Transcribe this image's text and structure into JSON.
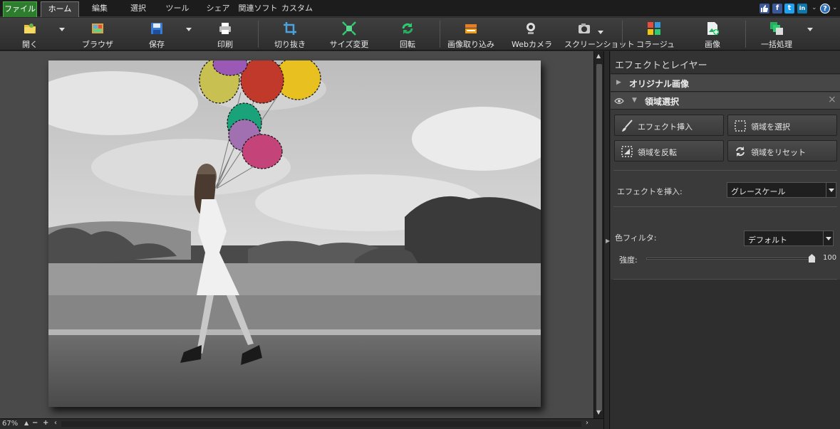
{
  "menu": {
    "tabs": [
      "ファイル",
      "ホーム",
      "編集",
      "選択",
      "ツール",
      "シェア",
      "関連ソフト",
      "カスタム"
    ],
    "social": [
      "like-icon",
      "facebook-icon",
      "twitter-icon",
      "linkedin-icon",
      "help-icon"
    ],
    "social_glyphs": {
      "facebook": "f",
      "twitter": "t",
      "linkedin": "in",
      "help": "?"
    }
  },
  "toolbar": {
    "open": "開く",
    "browse": "ブラウザ",
    "save": "保存",
    "print": "印刷",
    "crop": "切り抜き",
    "resize": "サイズ変更",
    "rotate": "回転",
    "import": "画像取り込み",
    "webcam": "Webカメラ",
    "screenshot": "スクリーンショット",
    "collage": "コラージュ",
    "image": "画像",
    "batch": "一括処理"
  },
  "status": {
    "zoom": "67%",
    "zoom_out": "−",
    "zoom_in": "+",
    "scroll_left": "‹",
    "scroll_right": "›",
    "scroll_up": "▲",
    "scroll_down": "▼"
  },
  "panel": {
    "title": "エフェクトとレイヤー",
    "original": "オリジナル画像",
    "layer": "領域選択",
    "close_glyph": "×",
    "expand_glyph": "▶",
    "collapse_glyph": "▼",
    "buttons": {
      "insert_effect": "エフェクト挿入",
      "select_region": "領域を選択",
      "invert_region": "領域を反転",
      "reset_region": "領域をリセット"
    },
    "effect_label": "エフェクトを挿入:",
    "effect_value": "グレースケール",
    "color_filter_label": "色フィルタ:",
    "color_filter_value": "デフォルト",
    "strength_label": "強度:",
    "strength_value": "100",
    "strength_fraction": 1.0
  },
  "colors": {
    "accent_green": "#2e7d2e",
    "balloon_red": "#c0392b",
    "balloon_yellow": "#e8c020",
    "balloon_teal": "#1aa37a",
    "balloon_pink": "#c4447a",
    "balloon_purple": "#9b59b6"
  }
}
